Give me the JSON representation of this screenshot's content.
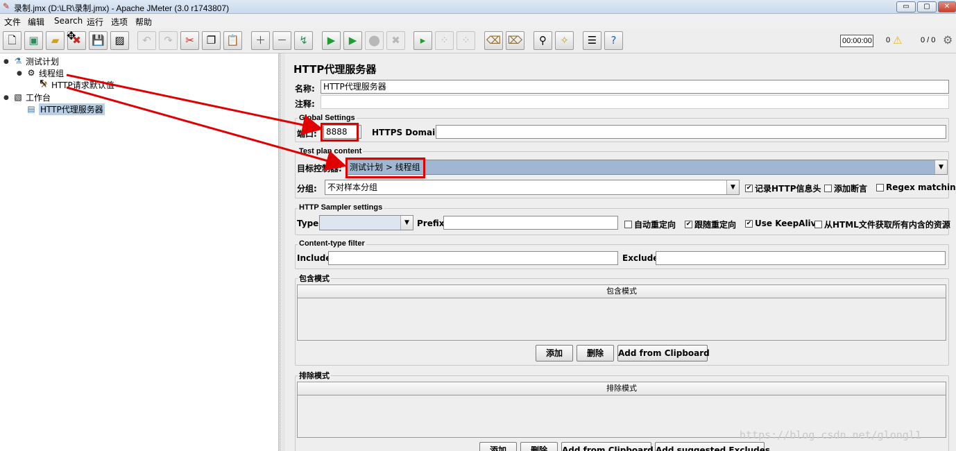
{
  "window": {
    "title": "录制.jmx (D:\\LR\\录制.jmx) - Apache JMeter (3.0 r1743807)",
    "minimize": "▭",
    "maximize": "▢",
    "close": "✕"
  },
  "menu": [
    "文件",
    "编辑",
    "Search",
    "运行",
    "选项",
    "帮助"
  ],
  "toolbar": {
    "timer": "00:00:00",
    "warning_count": "0",
    "thread_count": "0 / 0"
  },
  "tree": {
    "test_plan": "测试计划",
    "thread_group": "线程组",
    "http_defaults": "HTTP请求默认值",
    "workbench": "工作台",
    "proxy": "HTTP代理服务器"
  },
  "panel": {
    "title": "HTTP代理服务器",
    "name_label": "名称:",
    "name_value": "HTTP代理服务器",
    "comment_label": "注释:",
    "comment_value": ""
  },
  "global_settings": {
    "legend": "Global Settings",
    "port_label": "端口:",
    "port_value": "8888",
    "https_label": "HTTPS Domains :",
    "https_value": ""
  },
  "test_plan_content": {
    "legend": "Test plan content",
    "target_label": "目标控制器:",
    "target_value": "测试计划 > 线程组",
    "group_label": "分组:",
    "group_value": "不对样本分组",
    "chk_record_headers": "记录HTTP信息头",
    "chk_add_assertions": "添加断言",
    "chk_regex": "Regex matching"
  },
  "sampler_settings": {
    "legend": "HTTP Sampler settings",
    "type_label": "Type:",
    "type_value": "",
    "prefix_label": "Prefix:",
    "prefix_value": "",
    "chk_auto_redirect": "自动重定向",
    "chk_follow_redirect": "跟随重定向",
    "chk_keepalive": "Use KeepAlive",
    "chk_fetch_resources": "从HTML文件获取所有内含的资源"
  },
  "content_filter": {
    "legend": "Content-type filter",
    "include_label": "Include:",
    "include_value": "",
    "exclude_label": "Exclude:",
    "exclude_value": ""
  },
  "include_patterns": {
    "legend": "包含模式",
    "column": "包含模式",
    "btn_add": "添加",
    "btn_delete": "删除",
    "btn_clipboard": "Add from Clipboard"
  },
  "exclude_patterns": {
    "legend": "排除模式",
    "column": "排除模式",
    "btn_add": "添加",
    "btn_delete": "删除",
    "btn_clipboard": "Add from Clipboard",
    "btn_suggested": "Add suggested Excludes"
  },
  "watermark": "https://blog.csdn.net/glongl1",
  "colors": {
    "annotation_red": "#e00000",
    "selection": "#b8cfe5",
    "target_combo_bg": "#9fb7d0"
  }
}
